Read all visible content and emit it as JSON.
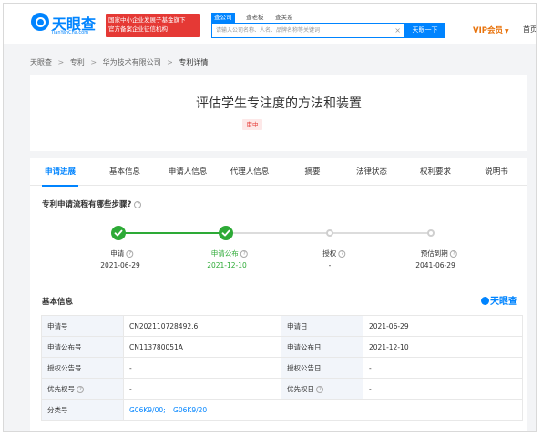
{
  "header": {
    "logo_text": "天眼查",
    "logo_sub": "TianYanCha.com",
    "promo_lines": [
      "国家中小企业发展子基金旗下",
      "官方备案企业征信机构"
    ],
    "search_tabs": [
      "查公司",
      "查老板",
      "查关系"
    ],
    "search_placeholder": "请输入公司名称、人名、品牌名称等关键词",
    "clear_icon": "×",
    "search_button": "天眼一下",
    "vip_label": "VIP会员",
    "vip_caret": "▼",
    "home_label": "首页"
  },
  "breadcrumb": [
    "天眼查",
    "专利",
    "华为技术有限公司",
    "专利详情"
  ],
  "breadcrumb_sep": ">",
  "patent": {
    "title": "评估学生专注度的方法和装置",
    "status": "审中"
  },
  "tabs": [
    "申请进展",
    "基本信息",
    "申请人信息",
    "代理人信息",
    "摘要",
    "法律状态",
    "权利要求",
    "说明书"
  ],
  "progress": {
    "question": "专利申请流程有哪些步骤?",
    "help_icon": "?",
    "steps": [
      {
        "label": "申请",
        "date": "2021-06-29",
        "state": "done"
      },
      {
        "label": "申请公布",
        "date": "2021-12-10",
        "state": "current"
      },
      {
        "label": "授权",
        "date": "-",
        "state": "todo"
      },
      {
        "label": "预估到期",
        "date": "2041-06-29",
        "state": "todo"
      }
    ]
  },
  "basic_info": {
    "title": "基本信息",
    "brand": "天眼查",
    "rows": [
      {
        "k1": "申请号",
        "v1": "CN202110728492.6",
        "k2": "申请日",
        "v2": "2021-06-29"
      },
      {
        "k1": "申请公布号",
        "v1": "CN113780051A",
        "k2": "申请公布日",
        "v2": "2021-12-10"
      },
      {
        "k1": "授权公告号",
        "v1": "-",
        "k2": "授权公告日",
        "v2": "-"
      },
      {
        "k1": "优先权号",
        "v1": "-",
        "k2": "优先权日",
        "v2": "-"
      }
    ],
    "classification_label": "分类号",
    "classification_links": [
      "G06K9/00;",
      "G06K9/20"
    ]
  },
  "colors": {
    "brand_blue": "#0084ff",
    "success_green": "#2daa36",
    "danger_red": "#e53935",
    "vip_orange": "#e8730c"
  }
}
